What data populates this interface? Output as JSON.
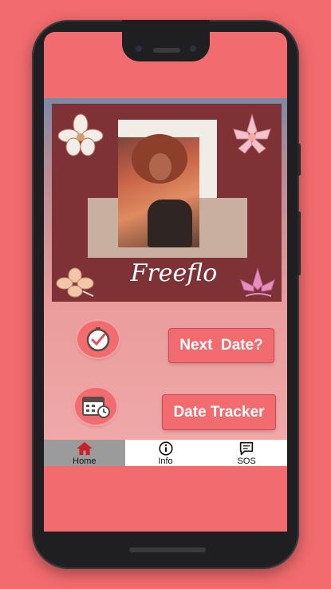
{
  "app": {
    "brand": "Freeflo"
  },
  "actions": {
    "next_date_label": "Next  Date?",
    "date_tracker_label": "Date Tracker"
  },
  "nav": {
    "items": [
      {
        "label": "Home",
        "icon": "home-icon",
        "active": true
      },
      {
        "label": "Info",
        "icon": "info-icon",
        "active": false
      },
      {
        "label": "SOS",
        "icon": "message-icon",
        "active": false
      }
    ]
  },
  "colors": {
    "background": "#f26b6e",
    "banner": "#7e3236",
    "accent": "#c84a55",
    "nav_active": "#9b9b9b"
  }
}
